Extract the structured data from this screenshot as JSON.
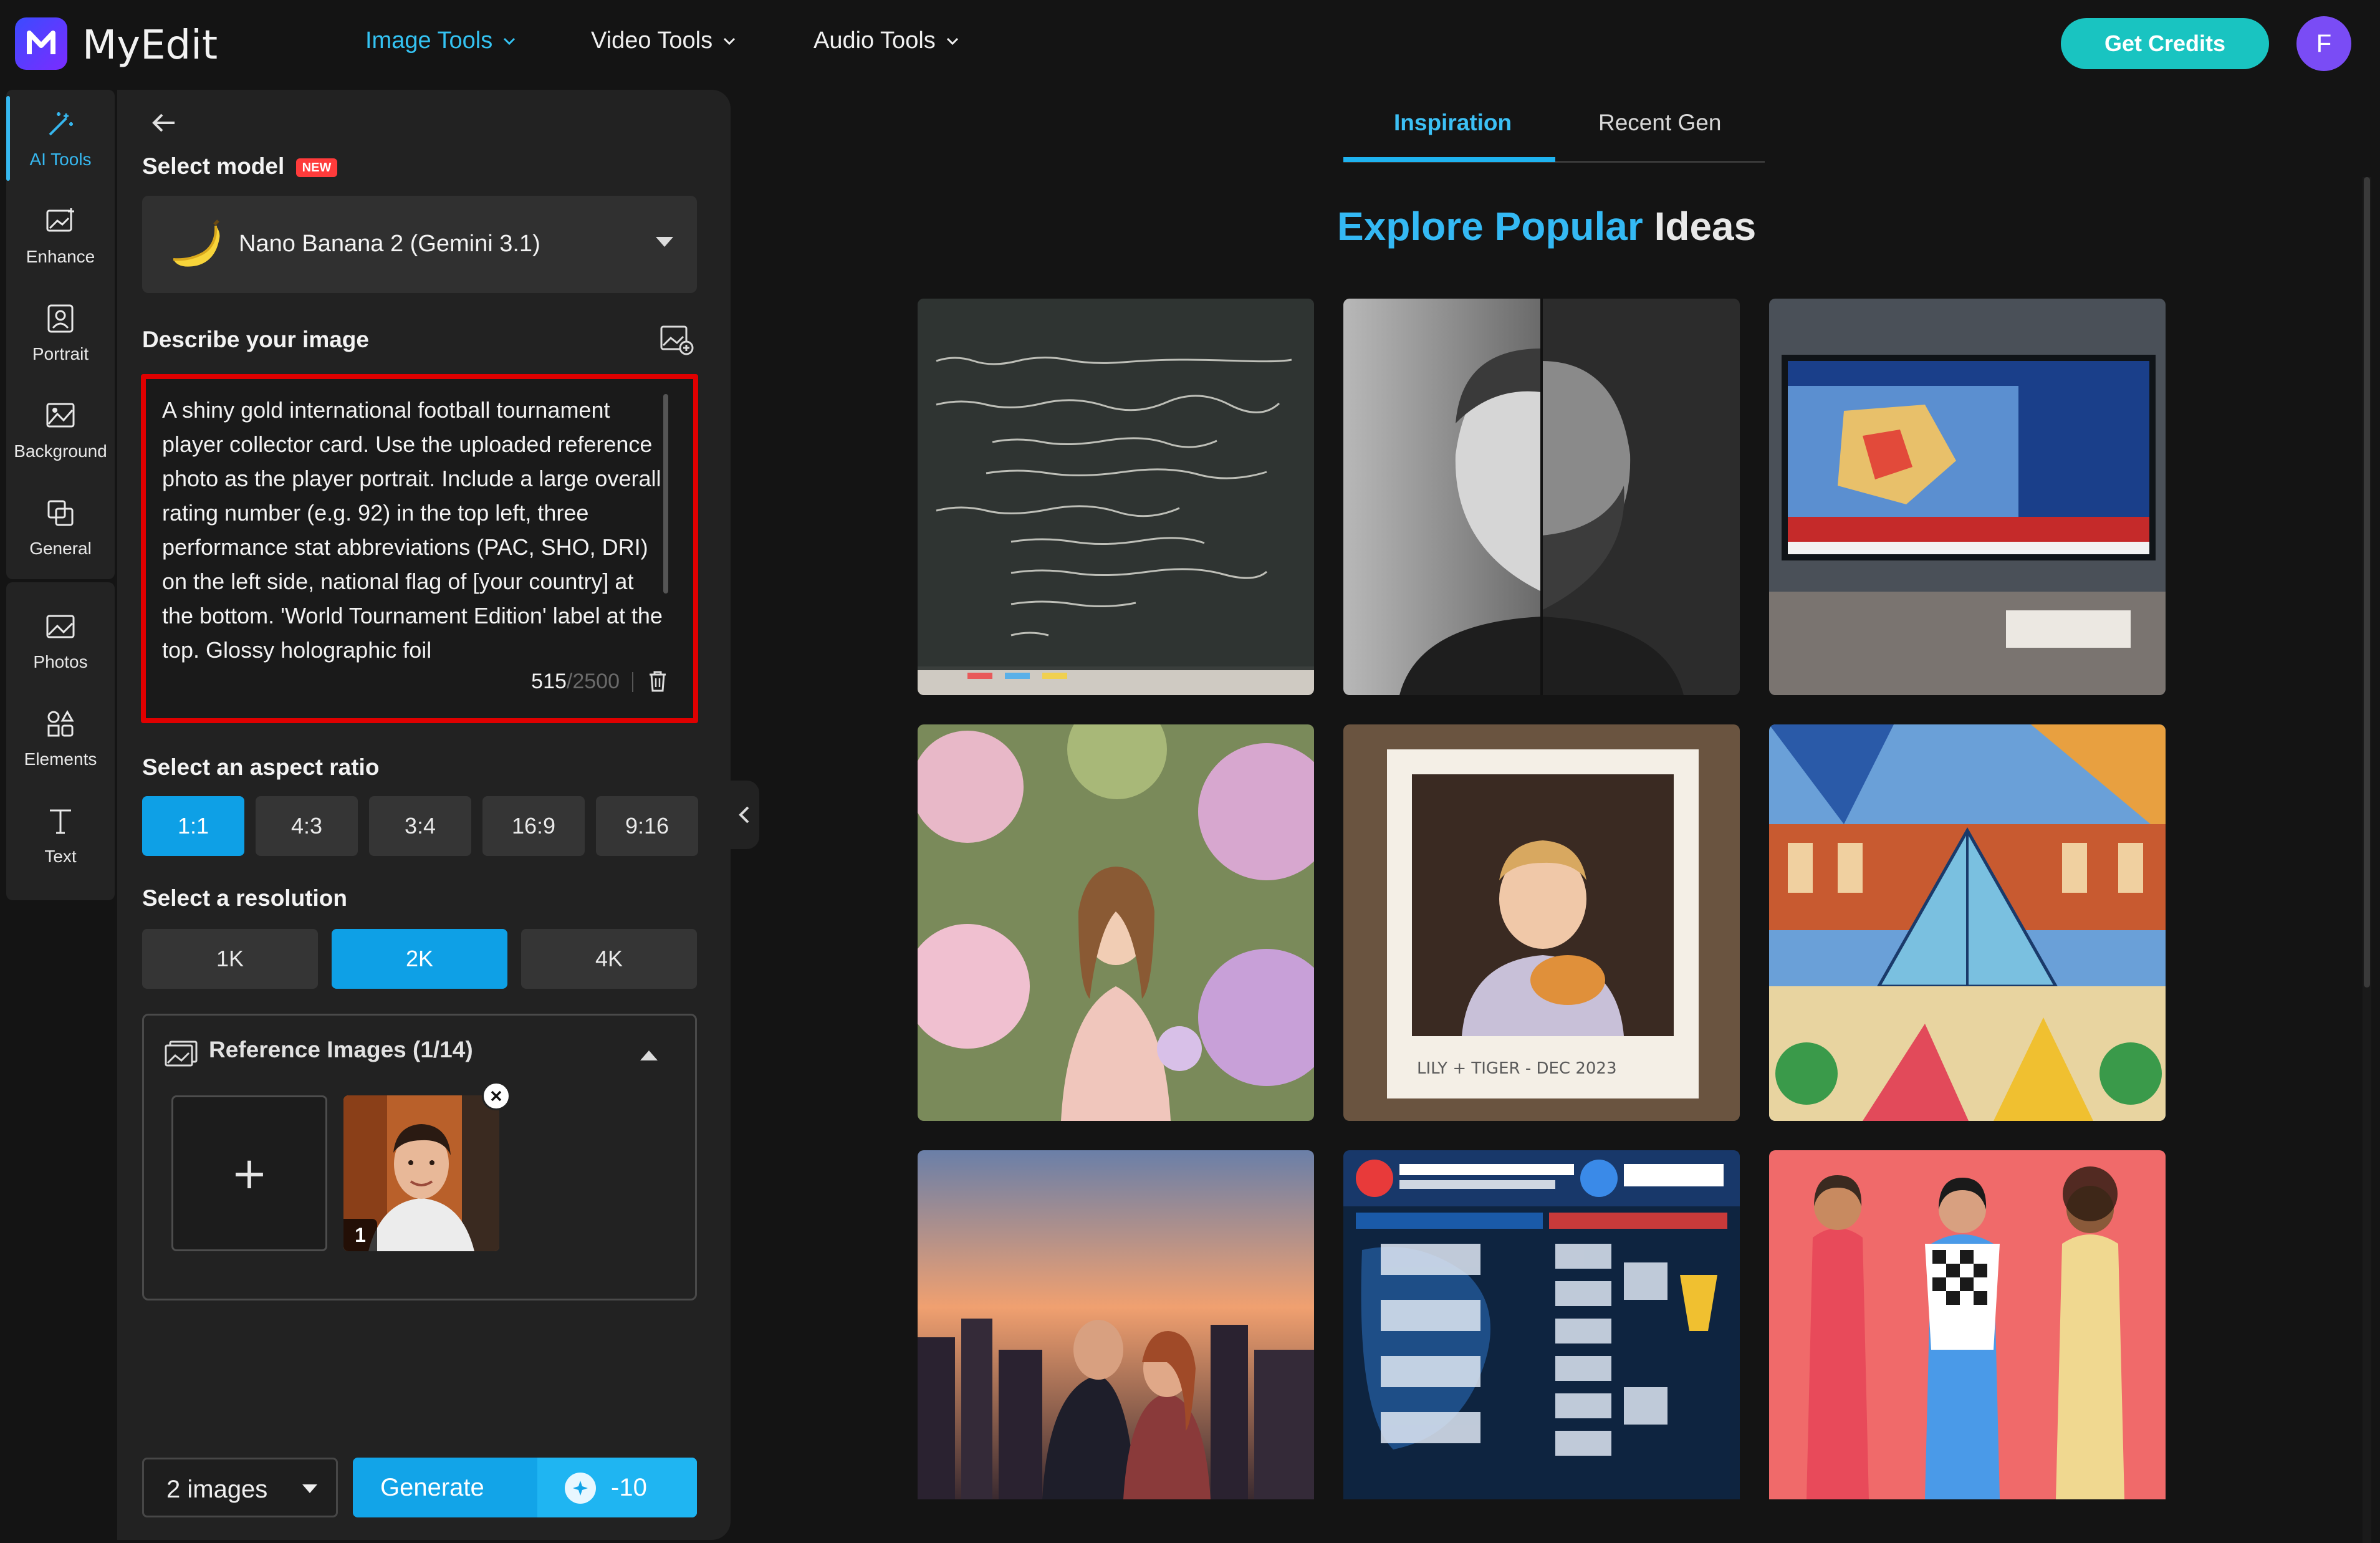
{
  "app": {
    "name": "MyEdit"
  },
  "nav": {
    "items": [
      {
        "label": "Image Tools",
        "active": true
      },
      {
        "label": "Video Tools",
        "active": false
      },
      {
        "label": "Audio Tools",
        "active": false
      }
    ],
    "credits_button": "Get Credits",
    "avatar_initial": "F"
  },
  "rail": {
    "items": [
      {
        "label": "AI Tools",
        "icon": "magic-wand-icon",
        "active": true
      },
      {
        "label": "Enhance",
        "icon": "enhance-icon"
      },
      {
        "label": "Portrait",
        "icon": "portrait-icon"
      },
      {
        "label": "Background",
        "icon": "background-icon"
      },
      {
        "label": "General",
        "icon": "general-icon"
      },
      {
        "label": "Photos",
        "icon": "photos-icon"
      },
      {
        "label": "Elements",
        "icon": "elements-icon"
      },
      {
        "label": "Text",
        "icon": "text-icon"
      }
    ],
    "plus": "+"
  },
  "panel": {
    "select_model_label": "Select model",
    "new_badge": "NEW",
    "model_name": "Nano Banana 2 (Gemini 3.1)",
    "describe_label": "Describe your image",
    "prompt_text": "A shiny gold international football tournament player collector card. Use the uploaded reference photo as the player portrait. Include a large overall rating number (e.g. 92) in the top left, three performance stat abbreviations (PAC, SHO, DRI) on the left side, national flag of [your country] at the bottom. 'World Tournament Edition' label at the top. Glossy holographic foil",
    "char_count": "515",
    "char_max": "/2500",
    "aspect_label": "Select an aspect ratio",
    "aspect_ratios": [
      "1:1",
      "4:3",
      "3:4",
      "16:9",
      "9:16"
    ],
    "aspect_selected": "1:1",
    "resolution_label": "Select a resolution",
    "resolutions": [
      "1K",
      "2K",
      "4K"
    ],
    "resolution_selected": "2K",
    "reference_title": "Reference Images (1/14)",
    "reference_add": "+",
    "reference_thumb_number": "1",
    "image_count": "2 images",
    "generate_label": "Generate",
    "generate_cost": "-10"
  },
  "content": {
    "tabs": [
      {
        "label": "Inspiration",
        "active": true
      },
      {
        "label": "Recent Gen",
        "active": false
      }
    ],
    "title_accent": "Explore Popular",
    "title_rest": "Ideas"
  },
  "colors": {
    "accent": "#0ea0e6",
    "teal_button": "#19c4c1",
    "highlight_border": "#e00000",
    "avatar": "#7a4cf5"
  }
}
